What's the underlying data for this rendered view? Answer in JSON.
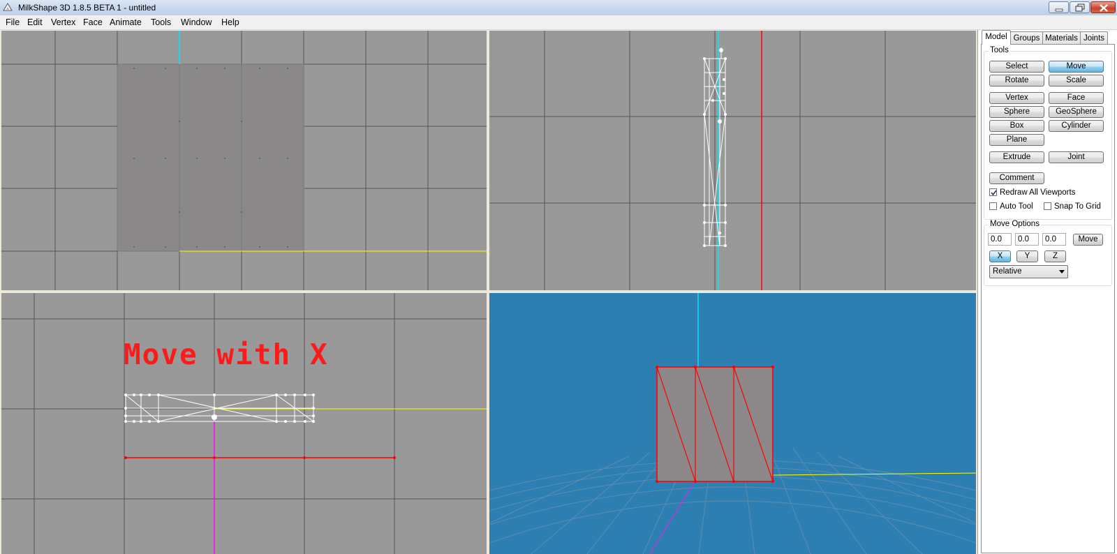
{
  "window": {
    "title": "MilkShape 3D 1.8.5 BETA 1 - untitled"
  },
  "menu": [
    "File",
    "Edit",
    "Vertex",
    "Face",
    "Animate",
    "Tools",
    "Window",
    "Help"
  ],
  "viewports": {
    "side_annotation": "Move with X"
  },
  "colors": {
    "viewport_gray": "#999999",
    "viewport_3d_blue": "#2e7fb1",
    "axis_cyan": "#00e5ff",
    "axis_yellow": "#ffff00",
    "axis_red": "#ff0000",
    "axis_magenta": "#ff00ff",
    "annotation_red": "#ff1a1a"
  },
  "panel": {
    "tabs": [
      "Model",
      "Groups",
      "Materials",
      "Joints"
    ],
    "active_tab": "Model",
    "tools": {
      "title": "Tools",
      "buttons": {
        "select": "Select",
        "move": "Move",
        "rotate": "Rotate",
        "scale": "Scale",
        "vertex": "Vertex",
        "face": "Face",
        "sphere": "Sphere",
        "geosphere": "GeoSphere",
        "box": "Box",
        "cylinder": "Cylinder",
        "plane": "Plane",
        "extrude": "Extrude",
        "joint": "Joint",
        "comment": "Comment"
      },
      "active_tool": "Move",
      "checkboxes": {
        "redraw_all": {
          "label": "Redraw All Viewports",
          "checked": true
        },
        "auto_tool": {
          "label": "Auto Tool",
          "checked": false
        },
        "snap_to_grid": {
          "label": "Snap To Grid",
          "checked": false
        }
      }
    },
    "move_options": {
      "title": "Move Options",
      "x_value": "0.0",
      "y_value": "0.0",
      "z_value": "0.0",
      "move_button": "Move",
      "axis_x": "X",
      "axis_y": "Y",
      "axis_z": "Z",
      "active_axis": "X",
      "mode": "Relative"
    }
  }
}
